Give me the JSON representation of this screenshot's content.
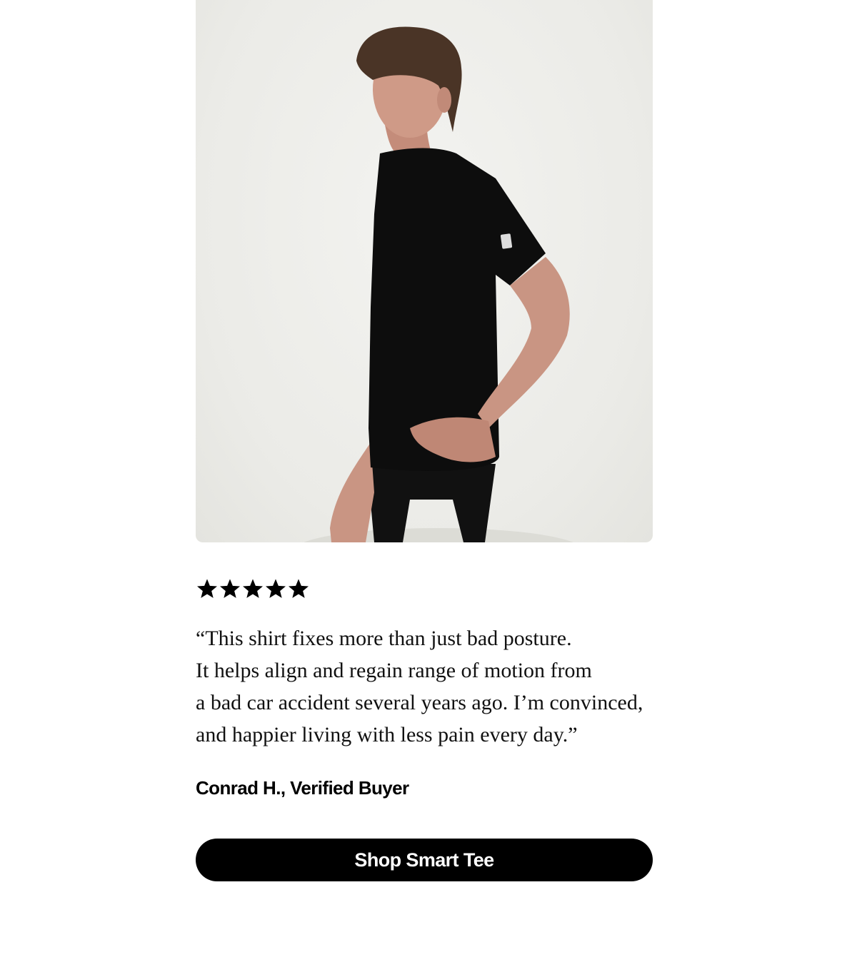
{
  "hero": {
    "image_alt": "Model wearing black Smart Tee",
    "shirt_color": "#0d0d0d",
    "background_color": "#efefeb"
  },
  "rating": {
    "stars": 5,
    "max": 5,
    "icon": "star-icon"
  },
  "review": {
    "quote_lines": [
      "“This shirt fixes more than just bad posture.",
      "It helps align and regain range of motion from",
      "a bad car accident several years ago. I’m convinced,",
      "and happier living with less pain every day.”"
    ],
    "author": "Conrad H., Verified Buyer"
  },
  "cta": {
    "label": "Shop Smart Tee",
    "background": "#000000",
    "color": "#ffffff"
  }
}
